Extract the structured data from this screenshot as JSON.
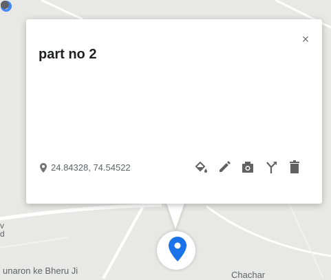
{
  "card": {
    "title": "part no 2",
    "close_label": "×",
    "coordinates": "24.84328, 74.54522"
  },
  "actions": [
    {
      "icon": "fill-color-icon"
    },
    {
      "icon": "pencil-icon"
    },
    {
      "icon": "camera-icon"
    },
    {
      "icon": "route-icon"
    },
    {
      "icon": "trash-icon"
    }
  ],
  "map": {
    "place_label_left": "unaron ke Bheru Ji",
    "place_label_right": "Chachar",
    "side_label": "v\nd"
  },
  "colors": {
    "pin": "#1a73e8",
    "map_background": "#e8e8e6",
    "road": "#ffffff",
    "poi": "#4285f4"
  }
}
